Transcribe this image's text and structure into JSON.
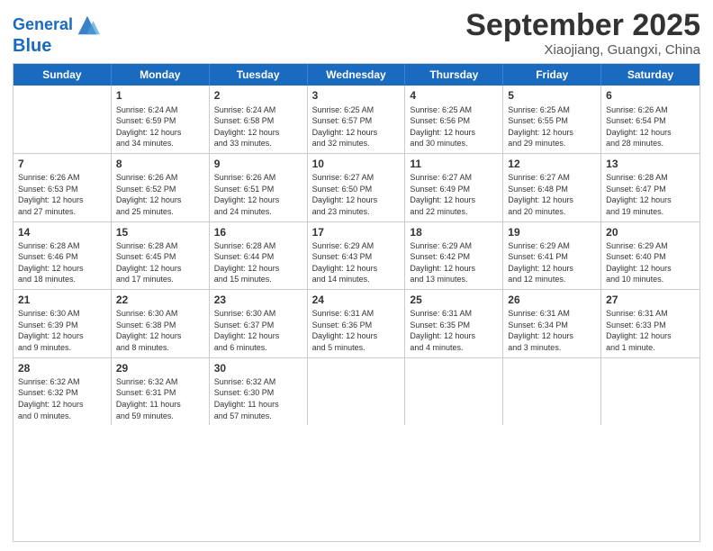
{
  "header": {
    "logo_line1": "General",
    "logo_line2": "Blue",
    "month": "September 2025",
    "location": "Xiaojiang, Guangxi, China"
  },
  "weekdays": [
    "Sunday",
    "Monday",
    "Tuesday",
    "Wednesday",
    "Thursday",
    "Friday",
    "Saturday"
  ],
  "rows": [
    [
      {
        "day": "",
        "info": ""
      },
      {
        "day": "1",
        "info": "Sunrise: 6:24 AM\nSunset: 6:59 PM\nDaylight: 12 hours\nand 34 minutes."
      },
      {
        "day": "2",
        "info": "Sunrise: 6:24 AM\nSunset: 6:58 PM\nDaylight: 12 hours\nand 33 minutes."
      },
      {
        "day": "3",
        "info": "Sunrise: 6:25 AM\nSunset: 6:57 PM\nDaylight: 12 hours\nand 32 minutes."
      },
      {
        "day": "4",
        "info": "Sunrise: 6:25 AM\nSunset: 6:56 PM\nDaylight: 12 hours\nand 30 minutes."
      },
      {
        "day": "5",
        "info": "Sunrise: 6:25 AM\nSunset: 6:55 PM\nDaylight: 12 hours\nand 29 minutes."
      },
      {
        "day": "6",
        "info": "Sunrise: 6:26 AM\nSunset: 6:54 PM\nDaylight: 12 hours\nand 28 minutes."
      }
    ],
    [
      {
        "day": "7",
        "info": "Sunrise: 6:26 AM\nSunset: 6:53 PM\nDaylight: 12 hours\nand 27 minutes."
      },
      {
        "day": "8",
        "info": "Sunrise: 6:26 AM\nSunset: 6:52 PM\nDaylight: 12 hours\nand 25 minutes."
      },
      {
        "day": "9",
        "info": "Sunrise: 6:26 AM\nSunset: 6:51 PM\nDaylight: 12 hours\nand 24 minutes."
      },
      {
        "day": "10",
        "info": "Sunrise: 6:27 AM\nSunset: 6:50 PM\nDaylight: 12 hours\nand 23 minutes."
      },
      {
        "day": "11",
        "info": "Sunrise: 6:27 AM\nSunset: 6:49 PM\nDaylight: 12 hours\nand 22 minutes."
      },
      {
        "day": "12",
        "info": "Sunrise: 6:27 AM\nSunset: 6:48 PM\nDaylight: 12 hours\nand 20 minutes."
      },
      {
        "day": "13",
        "info": "Sunrise: 6:28 AM\nSunset: 6:47 PM\nDaylight: 12 hours\nand 19 minutes."
      }
    ],
    [
      {
        "day": "14",
        "info": "Sunrise: 6:28 AM\nSunset: 6:46 PM\nDaylight: 12 hours\nand 18 minutes."
      },
      {
        "day": "15",
        "info": "Sunrise: 6:28 AM\nSunset: 6:45 PM\nDaylight: 12 hours\nand 17 minutes."
      },
      {
        "day": "16",
        "info": "Sunrise: 6:28 AM\nSunset: 6:44 PM\nDaylight: 12 hours\nand 15 minutes."
      },
      {
        "day": "17",
        "info": "Sunrise: 6:29 AM\nSunset: 6:43 PM\nDaylight: 12 hours\nand 14 minutes."
      },
      {
        "day": "18",
        "info": "Sunrise: 6:29 AM\nSunset: 6:42 PM\nDaylight: 12 hours\nand 13 minutes."
      },
      {
        "day": "19",
        "info": "Sunrise: 6:29 AM\nSunset: 6:41 PM\nDaylight: 12 hours\nand 12 minutes."
      },
      {
        "day": "20",
        "info": "Sunrise: 6:29 AM\nSunset: 6:40 PM\nDaylight: 12 hours\nand 10 minutes."
      }
    ],
    [
      {
        "day": "21",
        "info": "Sunrise: 6:30 AM\nSunset: 6:39 PM\nDaylight: 12 hours\nand 9 minutes."
      },
      {
        "day": "22",
        "info": "Sunrise: 6:30 AM\nSunset: 6:38 PM\nDaylight: 12 hours\nand 8 minutes."
      },
      {
        "day": "23",
        "info": "Sunrise: 6:30 AM\nSunset: 6:37 PM\nDaylight: 12 hours\nand 6 minutes."
      },
      {
        "day": "24",
        "info": "Sunrise: 6:31 AM\nSunset: 6:36 PM\nDaylight: 12 hours\nand 5 minutes."
      },
      {
        "day": "25",
        "info": "Sunrise: 6:31 AM\nSunset: 6:35 PM\nDaylight: 12 hours\nand 4 minutes."
      },
      {
        "day": "26",
        "info": "Sunrise: 6:31 AM\nSunset: 6:34 PM\nDaylight: 12 hours\nand 3 minutes."
      },
      {
        "day": "27",
        "info": "Sunrise: 6:31 AM\nSunset: 6:33 PM\nDaylight: 12 hours\nand 1 minute."
      }
    ],
    [
      {
        "day": "28",
        "info": "Sunrise: 6:32 AM\nSunset: 6:32 PM\nDaylight: 12 hours\nand 0 minutes."
      },
      {
        "day": "29",
        "info": "Sunrise: 6:32 AM\nSunset: 6:31 PM\nDaylight: 11 hours\nand 59 minutes."
      },
      {
        "day": "30",
        "info": "Sunrise: 6:32 AM\nSunset: 6:30 PM\nDaylight: 11 hours\nand 57 minutes."
      },
      {
        "day": "",
        "info": ""
      },
      {
        "day": "",
        "info": ""
      },
      {
        "day": "",
        "info": ""
      },
      {
        "day": "",
        "info": ""
      }
    ]
  ]
}
